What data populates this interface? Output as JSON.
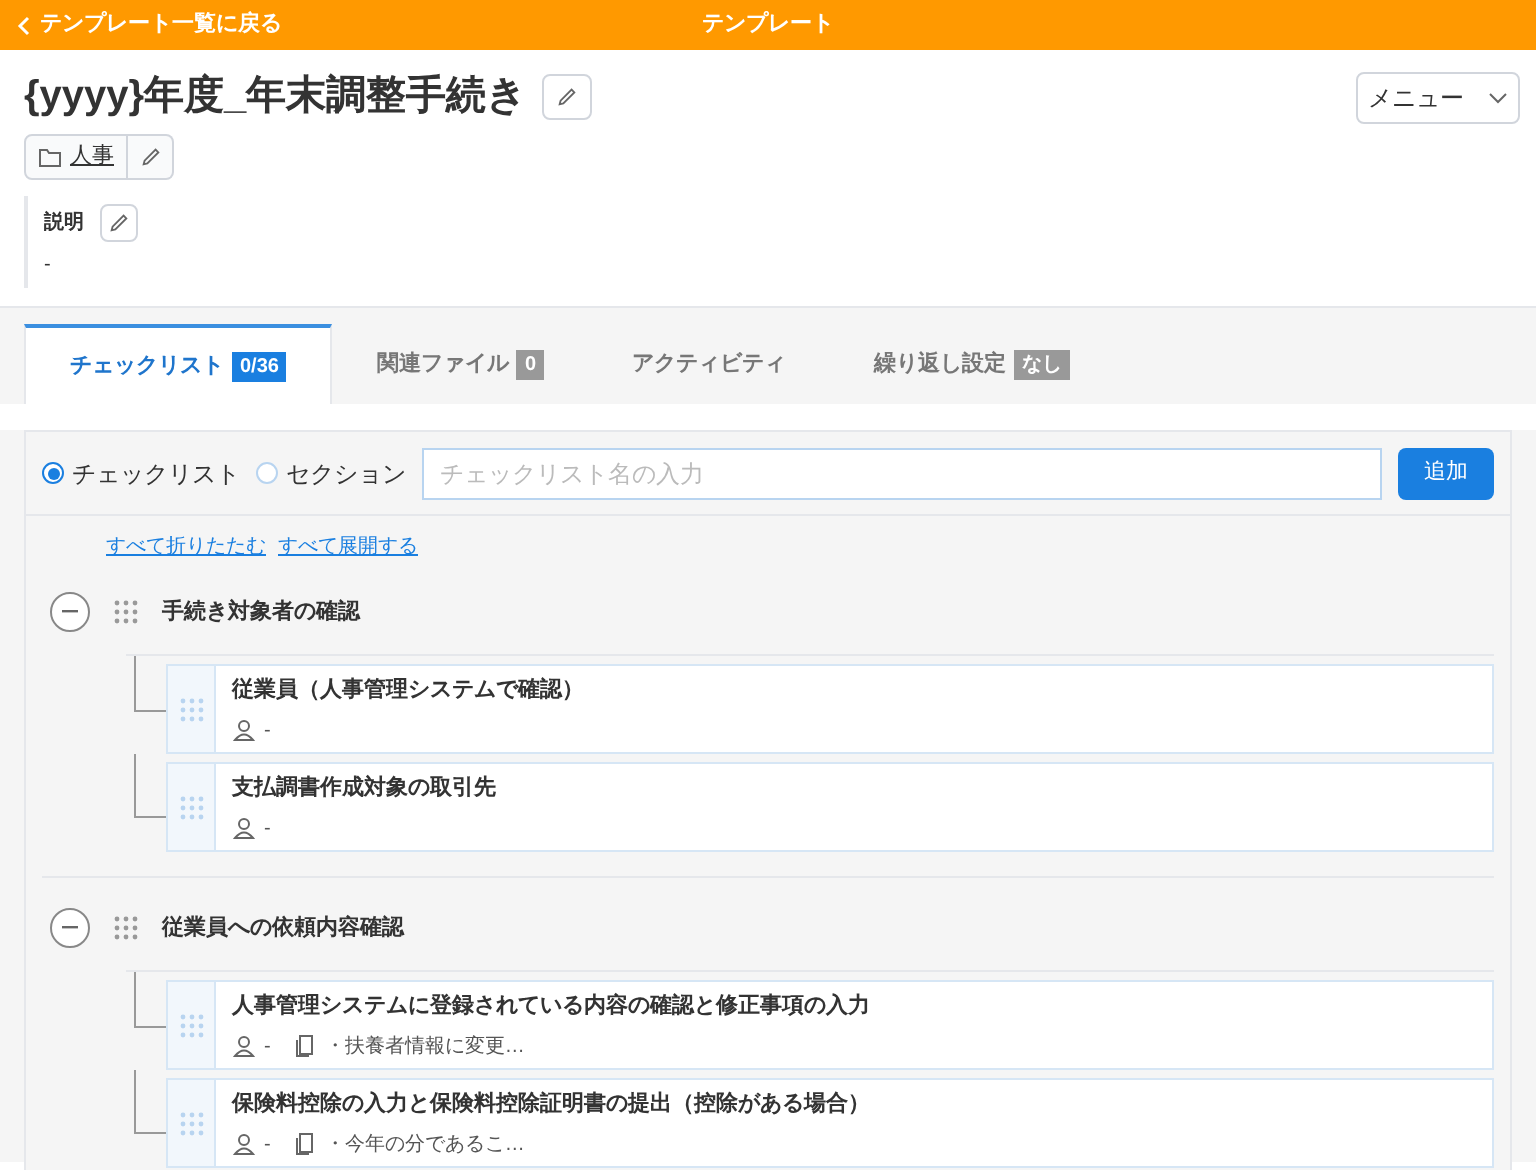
{
  "header": {
    "back_link": "テンプレート一覧に戻る",
    "title": "テンプレート"
  },
  "template": {
    "title": "{yyyy}年度_年末調整手続き",
    "menu": "メニュー",
    "folder": "人事",
    "description_label": "説明",
    "description": "-"
  },
  "tabs": [
    {
      "label": "チェックリスト",
      "badge": "0/36",
      "selected": true
    },
    {
      "label": "関連ファイル",
      "badge": "0",
      "selected": false
    },
    {
      "label": "アクティビティ",
      "selected": false
    },
    {
      "label": "繰り返し設定",
      "badge": "なし",
      "selected": false
    }
  ],
  "add_form": {
    "types": [
      {
        "label": "チェックリスト",
        "selected": true
      },
      {
        "label": "セクション",
        "selected": false
      }
    ],
    "placeholder": "チェックリスト名の入力",
    "button": "追加"
  },
  "links": [
    "すべて折りたたむ",
    "すべて展開する"
  ],
  "sections": [
    {
      "title": "手続き対象者の確認",
      "expanded": true,
      "items": [
        {
          "title": "従業員（人事管理システムで確認）",
          "assignee": "-"
        },
        {
          "title": "支払調書作成対象の取引先",
          "assignee": "-"
        }
      ]
    },
    {
      "title": "従業員への依頼内容確認",
      "expanded": true,
      "items": [
        {
          "title": "人事管理システムに登録されている内容の確認と修正事項の入力",
          "assignee": "-",
          "note": "・扶養者情報に変更…"
        },
        {
          "title": "保険料控除の入力と保険料控除証明書の提出（控除がある場合）",
          "assignee": "-",
          "note": "・今年の分であるこ…"
        }
      ]
    }
  ]
}
